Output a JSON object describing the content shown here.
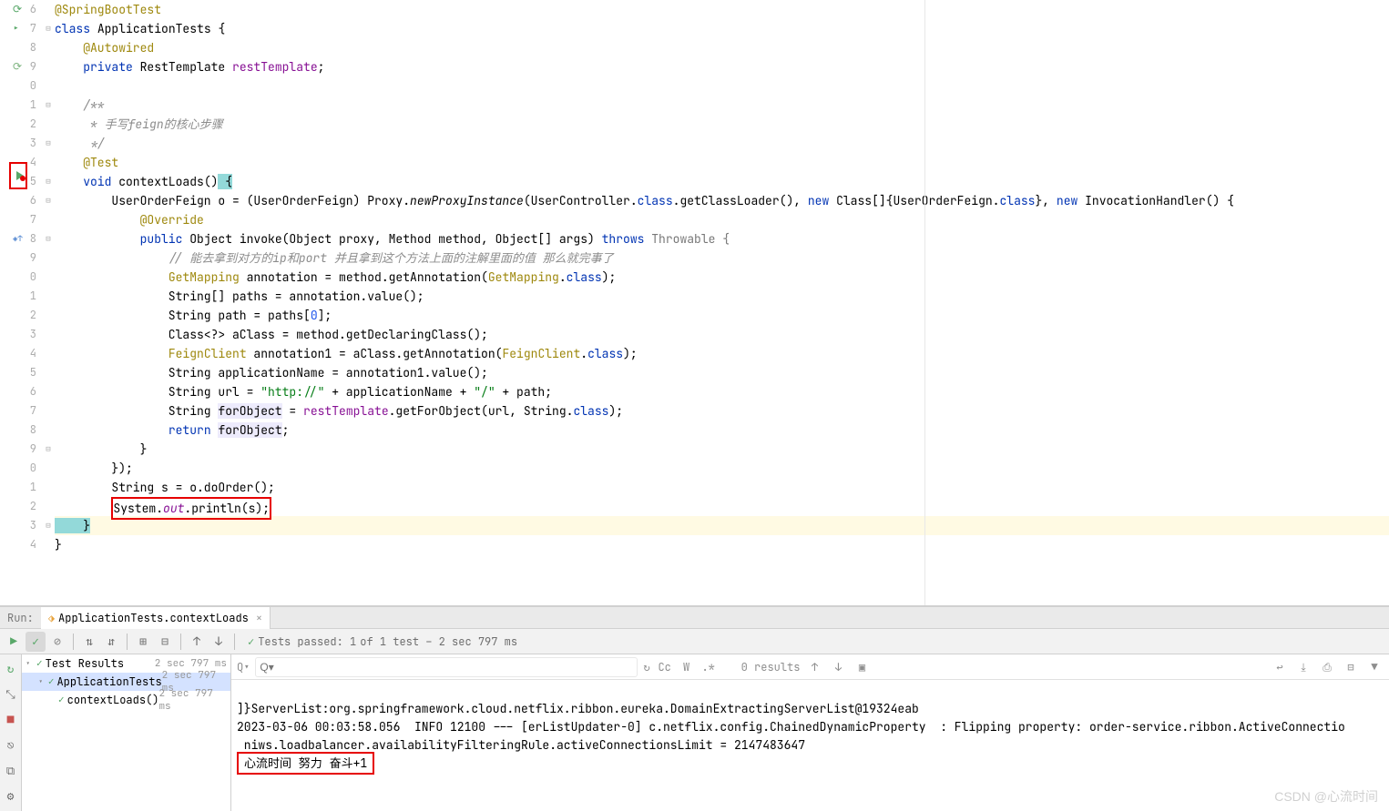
{
  "gutter": [
    "6",
    "7",
    "8",
    "9",
    "0",
    "1",
    "2",
    "3",
    "4",
    "5",
    "6",
    "7",
    "8",
    "9",
    "0",
    "1",
    "2",
    "3",
    "4",
    "5",
    "6",
    "7",
    "8",
    "9",
    "0",
    "1",
    "2",
    "3",
    "4"
  ],
  "code": {
    "l6": {
      "anno": "@SpringBootTest"
    },
    "l7": {
      "kw_class": "class",
      "cls": "ApplicationTests",
      "brace": " {"
    },
    "l8": {
      "indent": "    ",
      "anno": "@Autowired"
    },
    "l9": {
      "indent": "    ",
      "kw_private": "private",
      "cls": " RestTemplate ",
      "fld": "restTemplate",
      "semi": ";"
    },
    "l10": "",
    "l11": {
      "indent": "    ",
      "cmt": "/**"
    },
    "l12": {
      "indent": "     ",
      "cmt": "* 手写feign的核心步骤"
    },
    "l13": {
      "indent": "     ",
      "cmt": "*/"
    },
    "l14": {
      "indent": "    ",
      "anno": "@Test"
    },
    "l15": {
      "indent": "    ",
      "kw_void": "void",
      "mth": " contextLoads",
      "parens": "()",
      "brace": " {"
    },
    "l16_a": "        UserOrderFeign o = (UserOrderFeign) Proxy.",
    "l16_b": "newProxyInstance",
    "l16_c": "(UserController.",
    "l16_d": "class",
    "l16_e": ".getClassLoader(), ",
    "l16_f": "new",
    "l16_g": " Class[]{UserOrderFeign.",
    "l16_h": "class",
    "l16_i": "}, ",
    "l16_j": "new",
    "l16_k": " InvocationHandler() {",
    "l17": {
      "indent": "            ",
      "anno": "@Override"
    },
    "l18_a": "            ",
    "l18_b": "public",
    "l18_c": " Object invoke(Object proxy, Method method, Object[] args) ",
    "l18_d": "throws",
    "l18_e": " Throwable {",
    "l19": {
      "indent": "                ",
      "cmt": "// 能去拿到对方的ip和port 并且拿到这个方法上面的注解里面的值 那么就完事了"
    },
    "l20_a": "                ",
    "l20_b": "GetMapping",
    "l20_c": " annotation = method.getAnnotation(",
    "l20_d": "GetMapping",
    "l20_e": ".",
    "l20_f": "class",
    "l20_g": ");",
    "l21_a": "                String[] paths = annotation.value();",
    "l22_a": "                String path = paths[",
    "l22_b": "0",
    "l22_c": "];",
    "l23_a": "                Class<?> aClass = method.getDeclaringClass();",
    "l24_a": "                ",
    "l24_b": "FeignClient",
    "l24_c": " annotation1 = aClass.getAnnotation(",
    "l24_d": "FeignClient",
    "l24_e": ".",
    "l24_f": "class",
    "l24_g": ");",
    "l25_a": "                String applicationName = annotation1.value();",
    "l26_a": "                String url = ",
    "l26_b": "\"http://\"",
    "l26_c": " + applicationName + ",
    "l26_d": "\"/\"",
    "l26_e": " + path;",
    "l27_a": "                String ",
    "l27_b": "forObject",
    "l27_c": " = ",
    "l27_d": "restTemplate",
    "l27_e": ".getForObject(url, String.",
    "l27_f": "class",
    "l27_g": ");",
    "l28_a": "                ",
    "l28_b": "return",
    "l28_c": " ",
    "l28_d": "forObject",
    "l28_e": ";",
    "l29": "            }",
    "l30": "        });",
    "l31": "        String s = o.doOrder();",
    "l32_a": "        System.",
    "l32_b": "out",
    "l32_c": ".println(s);",
    "l33": "    }",
    "l34": "}"
  },
  "runTab": {
    "label": "Run:",
    "name": "ApplicationTests.contextLoads"
  },
  "testStatus": {
    "check": "✓",
    "text": "Tests passed: 1",
    "detail": " of 1 test – 2 sec 797 ms"
  },
  "tree": {
    "root": {
      "name": "Test Results",
      "time": "2 sec 797 ms"
    },
    "cls": {
      "name": "ApplicationTests",
      "time": "2 sec 797 ms"
    },
    "mth": {
      "name": "contextLoads()",
      "time": "2 sec 797 ms"
    }
  },
  "console": {
    "searchResults": "0 results",
    "line1": "]}ServerList:org.springframework.cloud.netflix.ribbon.eureka.DomainExtractingServerList@19324eab",
    "line2": "2023-03-06 00:03:58.056  INFO 12100 --- [erListUpdater-0] c.netflix.config.ChainedDynamicProperty  : Flipping property: order-service.ribbon.ActiveConnectio",
    "line3": " niws.loadbalancer.availabilityFilteringRule.activeConnectionsLimit = 2147483647",
    "line4": "心流时间 努力 奋斗+1",
    "searchPh": "Q▾"
  },
  "watermark": "CSDN @心流时间"
}
